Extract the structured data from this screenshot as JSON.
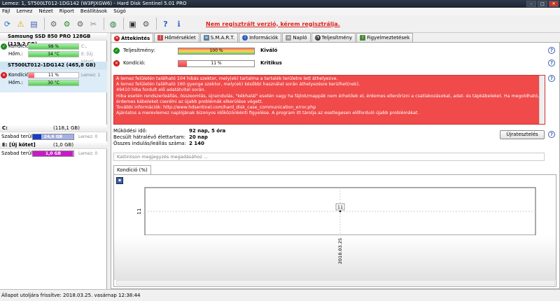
{
  "window": {
    "title": "Lemez: 1, ST500LT012-1DG142 (W3PJXGW6) - Hard Disk Sentinel 5.01 PRO"
  },
  "menu": [
    "Fájl",
    "Lemez",
    "Nézet",
    "Riport",
    "Beállítások",
    "Súgó"
  ],
  "toolbar": {
    "unregistered": "Nem regisztrált verzió, kérem regisztrálja."
  },
  "disks": [
    {
      "name": "Samsung SSD 850 PRO 128GB",
      "size": "(119,2 GB)",
      "disk_no": "Lemez: 0",
      "health_label": "Kondíció:",
      "health_value": "98 %",
      "health_pct": 98,
      "health_note": "C:,",
      "temp_label": "Hőm.:",
      "temp_value": "34 °C",
      "temp_note": "E: [Új kötet],"
    },
    {
      "name": "ST500LT012-1DG142",
      "size": "(465,8 GB)",
      "disk_no": "",
      "health_label": "Kondíció:",
      "health_value": "11 %",
      "health_pct": 11,
      "health_note": "Lemez: 1",
      "temp_label": "Hőm.:",
      "temp_value": "30 °C",
      "temp_note": ""
    }
  ],
  "partitions": [
    {
      "name": "C:",
      "size": "(118,1 GB)",
      "free_label": "Szabad terület",
      "free_value": "24,6 GB",
      "free_pct": 21,
      "free_color": "#1a3cc8",
      "note": "Lemez: 0"
    },
    {
      "name": "E: [Új kötet]",
      "size": "(1,0 GB)",
      "free_label": "Szabad terület",
      "free_value": "1,0 GB",
      "free_pct": 98,
      "free_color": "#c81ac8",
      "note": "Lemez: 0"
    }
  ],
  "tabs": [
    "Áttekintés",
    "Hőmérséklet",
    "S.M.A.R.T.",
    "Információk",
    "Napló",
    "Teljesítmény",
    "Figyelmeztetések"
  ],
  "overview": {
    "performance": {
      "label": "Teljesítmény:",
      "value": "100 %",
      "pct": 100,
      "status": "Kiváló"
    },
    "health": {
      "label": "Kondíció:",
      "value": "11 %",
      "pct": 11,
      "status": "Kritikus"
    },
    "alert_lines": [
      "A lemez felületén található 104 hibás szektor, mely(ek) tartalma a tartalék területre lett áthelyezve.",
      "A lemez felületén található 160 gyenge szektor, mely(ek) későbbi használat során áthelyezésre kerülhet(nek).",
      "49410 hiba fordult elő adatátvitel során.",
      "Hiba esetén rendszerleállás, összeomlás, újraindulás, \"kékhalál\" esetén vagy ha fájlok/mappák nem érhetőek el, érdemes ellenőrizni a csatlakozásokat, adat- és tápkábeleket. Ha megoldható, érdemes kábeleket cserélni az újabb problémák elkerülése végett.",
      "További információk: http://www.hdsentinel.com/hard_disk_case_communication_error.php",
      "Ajánlatos a merevlemez naplójának bizonyos időközönkénti figyelése. A program itt tárolja az esetlegesen előforduló újabb problémákat."
    ],
    "stats": [
      {
        "label": "Működési idő:",
        "value": "92 nap, 5 óra"
      },
      {
        "label": "Becsült hátralévő élettartam:",
        "value": "20 nap"
      },
      {
        "label": "Összes indulás/leállás száma:",
        "value": "2 140"
      }
    ],
    "retest_button": "Újratesztelés",
    "comment_placeholder": "Kattintson megjegyzés megadásához ...",
    "subtab": "Kondíció  (%)"
  },
  "chart_data": {
    "type": "line",
    "x": [
      "2018.03.25"
    ],
    "series": [
      {
        "values": [
          11
        ]
      }
    ],
    "ylim": [
      0,
      22
    ],
    "ytick_labels": [
      "11"
    ],
    "xtick_labels": [
      "2018.03.25"
    ],
    "data_labels": [
      "11"
    ],
    "grid": true
  },
  "statusbar": {
    "text": "Állapot utoljára frissítve: 2018.03.25. vasárnap 12:38:44"
  },
  "colors": {
    "ok": "#1e8c1e",
    "bad": "#d31d1d",
    "alert_bg": "#f04a4a",
    "link": "#3b5fb0"
  }
}
